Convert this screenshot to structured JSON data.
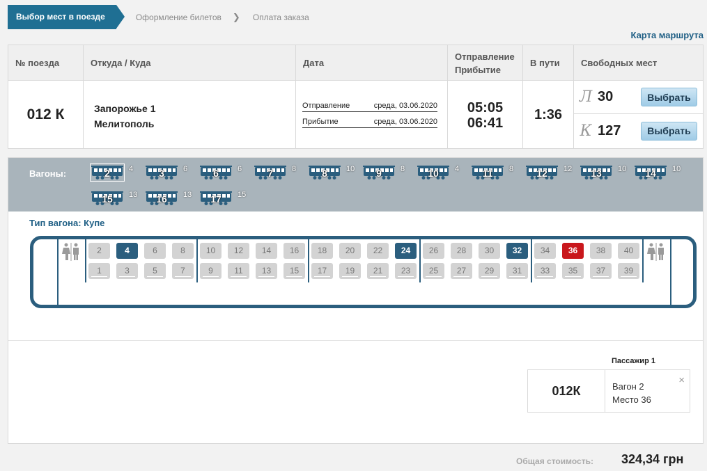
{
  "steps": [
    "Выбор мест в поезде",
    "Оформление билетов",
    "Оплата заказа"
  ],
  "route_map": "Карта маршрута",
  "table": {
    "headers": {
      "num": "№ поезда",
      "route": "Откуда / Куда",
      "date": "Дата",
      "depart_line1": "Отправление",
      "depart_line2": "Прибытие",
      "duration": "В пути",
      "free": "Свободных мест"
    },
    "train": "012 К",
    "from": "Запорожье 1",
    "to": "Мелитополь",
    "depart_label": "Отправление",
    "depart_date": "среда, 03.06.2020",
    "arrive_label": "Прибытие",
    "arrive_date": "среда, 03.06.2020",
    "depart_time": "05:05",
    "arrive_time": "06:41",
    "duration": "1:36",
    "seats": [
      {
        "letter": "Л",
        "count": "30",
        "button": "Выбрать"
      },
      {
        "letter": "К",
        "count": "127",
        "button": "Выбрать"
      }
    ]
  },
  "wagons_label": "Вагоны:",
  "wagons": [
    {
      "num": "2",
      "free": "4",
      "selected": true
    },
    {
      "num": "3",
      "free": "6"
    },
    {
      "num": "6",
      "free": "6"
    },
    {
      "num": "7",
      "free": "8"
    },
    {
      "num": "8",
      "free": "10"
    },
    {
      "num": "9",
      "free": "8"
    },
    {
      "num": "10",
      "free": "4"
    },
    {
      "num": "11",
      "free": "8"
    },
    {
      "num": "12",
      "free": "12"
    },
    {
      "num": "13",
      "free": "10"
    },
    {
      "num": "14",
      "free": "10"
    },
    {
      "num": "15",
      "free": "13"
    },
    {
      "num": "16",
      "free": "13"
    },
    {
      "num": "17",
      "free": "15"
    }
  ],
  "car_type": "Тип вагона: Купе",
  "seats_top": [
    "2",
    "4",
    "6",
    "8",
    "10",
    "12",
    "14",
    "16",
    "18",
    "20",
    "22",
    "24",
    "26",
    "28",
    "30",
    "32",
    "34",
    "36",
    "38",
    "40"
  ],
  "seats_bottom": [
    "1",
    "3",
    "5",
    "7",
    "9",
    "11",
    "13",
    "15",
    "17",
    "19",
    "21",
    "23",
    "25",
    "27",
    "29",
    "31",
    "33",
    "35",
    "37",
    "39"
  ],
  "chosen_seats": [
    "4",
    "24",
    "32"
  ],
  "occupied_seats": [
    "36"
  ],
  "passenger": {
    "title": "Пассажир 1",
    "train": "012К",
    "wagon": "Вагон 2",
    "seat": "Место 36",
    "close": "×"
  },
  "total": {
    "label": "Общая стоимость:",
    "value": "324,34 грн"
  },
  "colors": {
    "accent": "#1f6f93",
    "car_border": "#2b5e7e",
    "occupied": "#c9171c",
    "wagon_bar": "#a9b4bb"
  }
}
